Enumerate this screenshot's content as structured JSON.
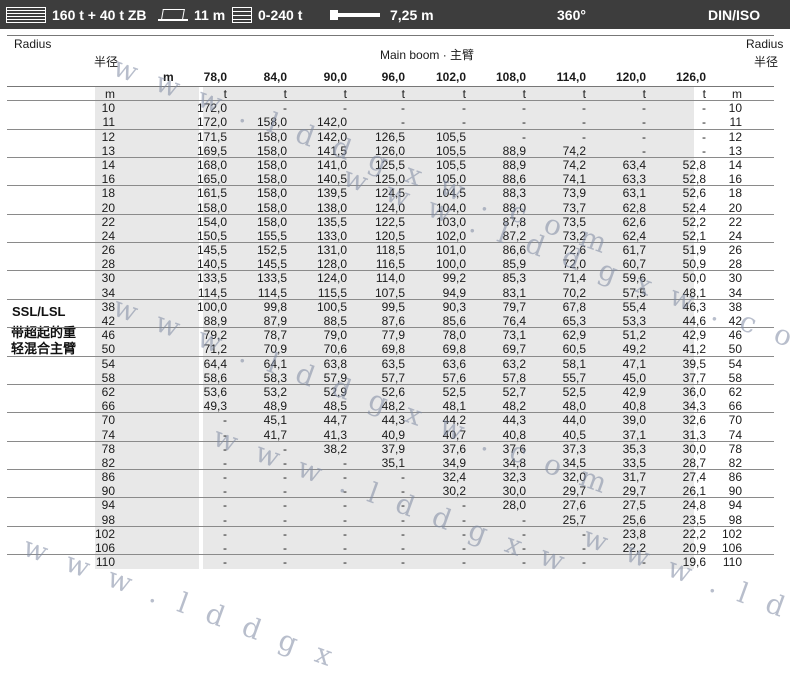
{
  "topbar": {
    "config": "160 t + 40 t ZB",
    "ballast_width": "11 m",
    "ballast_range": "0-240 t",
    "radius_offset": "7,25 m",
    "slew": "360°",
    "standard": "DIN/ISO"
  },
  "header": {
    "radius_left": "Radius",
    "radius_left_cn": "半径",
    "radius_right": "Radius",
    "radius_right_cn": "半径",
    "boom_label": "Main boom · 主臂",
    "unit_m": "m",
    "unit_t": "t",
    "boom_lengths": [
      "78,0",
      "84,0",
      "90,0",
      "96,0",
      "102,0",
      "108,0",
      "114,0",
      "120,0",
      "126,0"
    ]
  },
  "side_labels": {
    "system": "SSL/LSL",
    "desc_line1": "带超起的重",
    "desc_line2": "轻混合主臂"
  },
  "watermark": [
    "w w w . l d d g x w . c o m",
    "w w w . l d d g x w . c o m",
    "w w w . l d d g x w . c o m",
    "w w w . l d",
    "w w w . l d d g x w",
    "w w w . l d d g x"
  ],
  "table": {
    "rows": [
      {
        "r": "10",
        "v": [
          "172,0",
          "-",
          "-",
          "-",
          "-",
          "-",
          "-",
          "-",
          "-"
        ]
      },
      {
        "r": "11",
        "v": [
          "172,0",
          "158,0",
          "142,0",
          "-",
          "-",
          "-",
          "-",
          "-",
          "-"
        ]
      },
      {
        "r": "12",
        "v": [
          "171,5",
          "158,0",
          "142,0",
          "126,5",
          "105,5",
          "-",
          "-",
          "-",
          "-"
        ]
      },
      {
        "r": "13",
        "v": [
          "169,5",
          "158,0",
          "141,5",
          "126,0",
          "105,5",
          "88,9",
          "74,2",
          "-",
          "-"
        ]
      },
      {
        "r": "14",
        "v": [
          "168,0",
          "158,0",
          "141,0",
          "125,5",
          "105,5",
          "88,9",
          "74,2",
          "63,4",
          "52,8"
        ]
      },
      {
        "r": "16",
        "v": [
          "165,0",
          "158,0",
          "140,5",
          "125,0",
          "105,0",
          "88,6",
          "74,1",
          "63,3",
          "52,8"
        ]
      },
      {
        "r": "18",
        "v": [
          "161,5",
          "158,0",
          "139,5",
          "124,5",
          "104,5",
          "88,3",
          "73,9",
          "63,1",
          "52,6"
        ]
      },
      {
        "r": "20",
        "v": [
          "158,0",
          "158,0",
          "138,0",
          "124,0",
          "104,0",
          "88,0",
          "73,7",
          "62,8",
          "52,4"
        ]
      },
      {
        "r": "22",
        "v": [
          "154,0",
          "158,0",
          "135,5",
          "122,5",
          "103,0",
          "87,8",
          "73,5",
          "62,6",
          "52,2"
        ]
      },
      {
        "r": "24",
        "v": [
          "150,5",
          "155,5",
          "133,0",
          "120,5",
          "102,0",
          "87,2",
          "73,2",
          "62,4",
          "52,1"
        ]
      },
      {
        "r": "26",
        "v": [
          "145,5",
          "152,5",
          "131,0",
          "118,5",
          "101,0",
          "86,6",
          "72,6",
          "61,7",
          "51,9"
        ]
      },
      {
        "r": "28",
        "v": [
          "140,5",
          "145,5",
          "128,0",
          "116,5",
          "100,0",
          "85,9",
          "72,0",
          "60,7",
          "50,9"
        ]
      },
      {
        "r": "30",
        "v": [
          "133,5",
          "133,5",
          "124,0",
          "114,0",
          "99,2",
          "85,3",
          "71,4",
          "59,6",
          "50,0"
        ]
      },
      {
        "r": "34",
        "v": [
          "114,5",
          "114,5",
          "115,5",
          "107,5",
          "94,9",
          "83,1",
          "70,2",
          "57,5",
          "48,1"
        ]
      },
      {
        "r": "38",
        "v": [
          "100,0",
          "99,8",
          "100,5",
          "99,5",
          "90,3",
          "79,7",
          "67,8",
          "55,4",
          "46,3"
        ]
      },
      {
        "r": "42",
        "v": [
          "88,9",
          "87,9",
          "88,5",
          "87,6",
          "85,6",
          "76,4",
          "65,3",
          "53,3",
          "44,6"
        ]
      },
      {
        "r": "46",
        "v": [
          "79,2",
          "78,7",
          "79,0",
          "77,9",
          "78,0",
          "73,1",
          "62,9",
          "51,2",
          "42,9"
        ]
      },
      {
        "r": "50",
        "v": [
          "71,2",
          "70,9",
          "70,6",
          "69,8",
          "69,8",
          "69,7",
          "60,5",
          "49,2",
          "41,2"
        ]
      },
      {
        "r": "54",
        "v": [
          "64,4",
          "64,1",
          "63,8",
          "63,5",
          "63,6",
          "63,2",
          "58,1",
          "47,1",
          "39,5"
        ]
      },
      {
        "r": "58",
        "v": [
          "58,6",
          "58,3",
          "57,9",
          "57,7",
          "57,6",
          "57,8",
          "55,7",
          "45,0",
          "37,7"
        ]
      },
      {
        "r": "62",
        "v": [
          "53,6",
          "53,2",
          "52,9",
          "52,6",
          "52,5",
          "52,7",
          "52,5",
          "42,9",
          "36,0"
        ]
      },
      {
        "r": "66",
        "v": [
          "49,3",
          "48,9",
          "48,5",
          "48,2",
          "48,1",
          "48,2",
          "48,0",
          "40,8",
          "34,3"
        ]
      },
      {
        "r": "70",
        "v": [
          "-",
          "45,1",
          "44,7",
          "44,3",
          "44,2",
          "44,3",
          "44,0",
          "39,0",
          "32,6"
        ]
      },
      {
        "r": "74",
        "v": [
          "-",
          "41,7",
          "41,3",
          "40,9",
          "40,7",
          "40,8",
          "40,5",
          "37,1",
          "31,3"
        ]
      },
      {
        "r": "78",
        "v": [
          "-",
          "-",
          "38,2",
          "37,9",
          "37,6",
          "37,6",
          "37,3",
          "35,3",
          "30,0"
        ]
      },
      {
        "r": "82",
        "v": [
          "-",
          "-",
          "-",
          "35,1",
          "34,9",
          "34,8",
          "34,5",
          "33,5",
          "28,7"
        ]
      },
      {
        "r": "86",
        "v": [
          "-",
          "-",
          "-",
          "-",
          "32,4",
          "32,3",
          "32,0",
          "31,7",
          "27,4"
        ]
      },
      {
        "r": "90",
        "v": [
          "-",
          "-",
          "-",
          "-",
          "30,2",
          "30,0",
          "29,7",
          "29,7",
          "26,1"
        ]
      },
      {
        "r": "94",
        "v": [
          "-",
          "-",
          "-",
          "-",
          "-",
          "28,0",
          "27,6",
          "27,5",
          "24,8"
        ]
      },
      {
        "r": "98",
        "v": [
          "-",
          "-",
          "-",
          "-",
          "-",
          "-",
          "25,7",
          "25,6",
          "23,5"
        ]
      },
      {
        "r": "102",
        "v": [
          "-",
          "-",
          "-",
          "-",
          "-",
          "-",
          "-",
          "23,8",
          "22,2"
        ]
      },
      {
        "r": "106",
        "v": [
          "-",
          "-",
          "-",
          "-",
          "-",
          "-",
          "-",
          "22,2",
          "20,9"
        ]
      },
      {
        "r": "110",
        "v": [
          "-",
          "-",
          "-",
          "-",
          "-",
          "-",
          "-",
          "-",
          "19,6"
        ]
      }
    ]
  }
}
